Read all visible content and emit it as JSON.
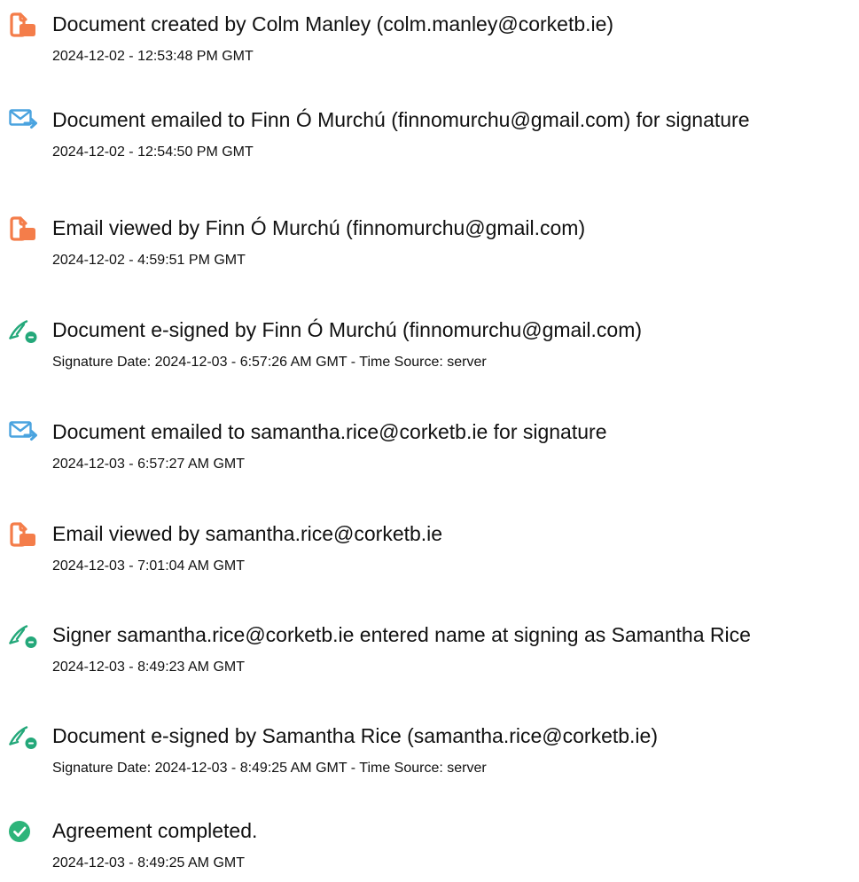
{
  "colors": {
    "document_orange": "#f47d4a",
    "email_blue": "#4aa3df",
    "esign_green": "#24a87a",
    "complete_green": "#2db47a",
    "text": "#111111"
  },
  "events": [
    {
      "icon": "document-icon",
      "title": "Document created by Colm Manley (colm.manley@corketb.ie)",
      "detail": "2024-12-02 - 12:53:48 PM GMT"
    },
    {
      "icon": "email-icon",
      "title": "Document emailed to Finn Ó Murchú (finnomurchu@gmail.com) for signature",
      "detail": "2024-12-02 - 12:54:50 PM GMT"
    },
    {
      "icon": "document-icon",
      "title": "Email viewed by Finn Ó Murchú (finnomurchu@gmail.com)",
      "detail": "2024-12-02 - 4:59:51 PM GMT"
    },
    {
      "icon": "esign-icon",
      "title": "Document e-signed by Finn Ó Murchú (finnomurchu@gmail.com)",
      "detail": "Signature Date: 2024-12-03 - 6:57:26 AM GMT - Time Source: server"
    },
    {
      "icon": "email-icon",
      "title": "Document emailed to samantha.rice@corketb.ie for signature",
      "detail": "2024-12-03 - 6:57:27 AM GMT"
    },
    {
      "icon": "document-icon",
      "title": "Email viewed by samantha.rice@corketb.ie",
      "detail": "2024-12-03 - 7:01:04 AM GMT"
    },
    {
      "icon": "esign-icon",
      "title": "Signer samantha.rice@corketb.ie entered name at signing as Samantha Rice",
      "detail": "2024-12-03 - 8:49:23 AM GMT"
    },
    {
      "icon": "esign-icon",
      "title": "Document e-signed by Samantha Rice (samantha.rice@corketb.ie)",
      "detail": "Signature Date: 2024-12-03 - 8:49:25 AM GMT - Time Source: server"
    },
    {
      "icon": "check-circle-icon",
      "title": "Agreement completed.",
      "detail": "2024-12-03 - 8:49:25 AM GMT"
    }
  ]
}
